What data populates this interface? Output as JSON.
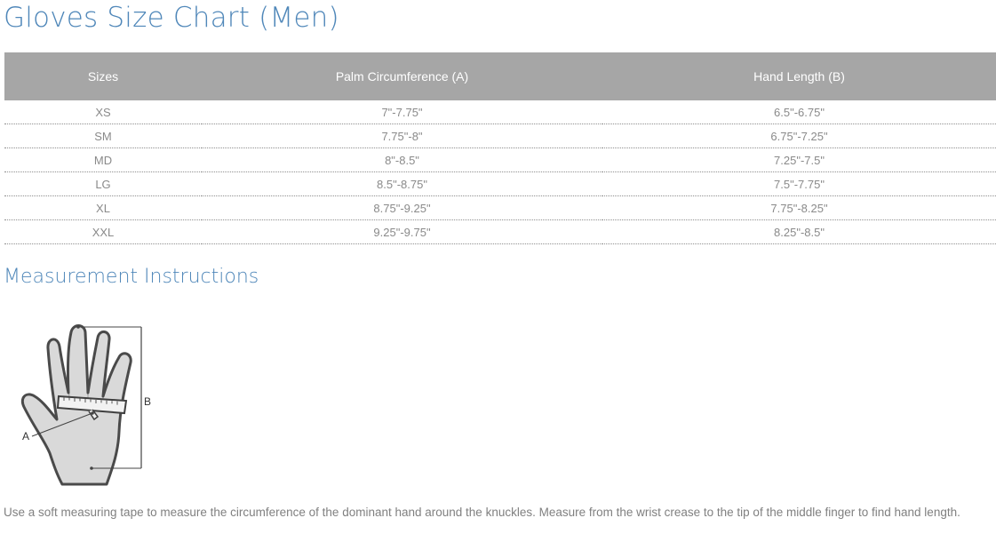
{
  "page_title": "Gloves Size Chart (Men)",
  "table": {
    "headers": [
      "Sizes",
      "Palm Circumference (A)",
      "Hand Length (B)"
    ],
    "rows": [
      [
        "XS",
        "7\"-7.75\"",
        "6.5\"-6.75\""
      ],
      [
        "SM",
        "7.75\"-8\"",
        "6.75\"-7.25\""
      ],
      [
        "MD",
        "8\"-8.5\"",
        "7.25\"-7.5\""
      ],
      [
        "LG",
        "8.5\"-8.75\"",
        "7.5\"-7.75\""
      ],
      [
        "XL",
        "8.75\"-9.25\"",
        "7.75\"-8.25\""
      ],
      [
        "XXL",
        "9.25\"-9.75\"",
        "8.25\"-8.5\""
      ]
    ]
  },
  "measurement": {
    "title": "Measurement Instructions",
    "diagram": {
      "label_a": "A",
      "label_b": "B"
    },
    "text": "Use a soft measuring tape to measure the circumference of the dominant hand around the knuckles. Measure from the wrist crease to the tip of the middle finger to find hand length."
  }
}
